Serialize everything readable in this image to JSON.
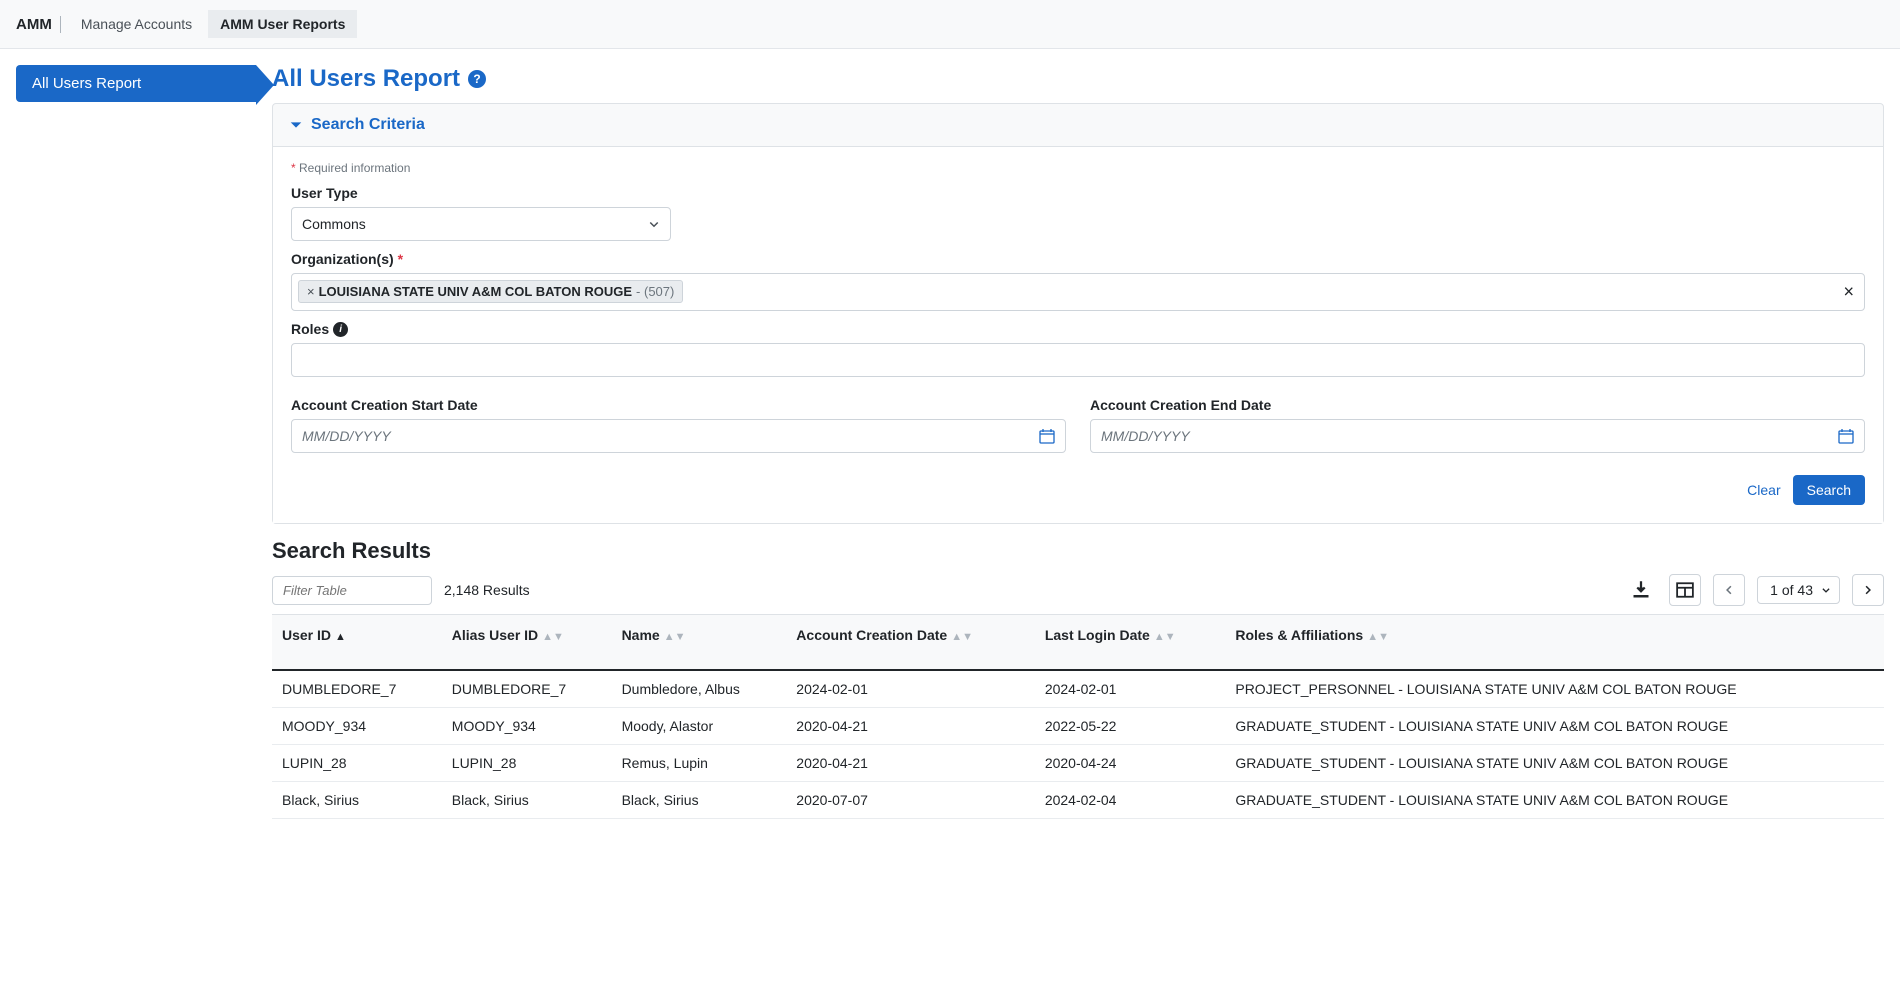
{
  "topnav": {
    "brand": "AMM",
    "items": [
      "Manage Accounts",
      "AMM User Reports"
    ],
    "active_index": 1
  },
  "sidebar": {
    "active_label": "All Users Report"
  },
  "page": {
    "title": "All Users Report"
  },
  "search_criteria": {
    "header": "Search Criteria",
    "required_note": "Required information",
    "user_type_label": "User Type",
    "user_type_value": "Commons",
    "org_label": "Organization(s)",
    "org_chip_name": "LOUISIANA STATE UNIV A&M COL BATON ROUGE",
    "org_chip_count": "- (507)",
    "roles_label": "Roles",
    "start_date_label": "Account Creation Start Date",
    "end_date_label": "Account Creation End Date",
    "date_placeholder": "MM/DD/YYYY",
    "clear_label": "Clear",
    "search_label": "Search"
  },
  "results": {
    "title": "Search Results",
    "filter_placeholder": "Filter Table",
    "count_text": "2,148 Results",
    "pager_text": "1 of 43",
    "columns": {
      "user_id": "User ID",
      "alias": "Alias User ID",
      "name": "Name",
      "created": "Account Creation Date",
      "last_login": "Last Login Date",
      "roles": "Roles & Affiliations"
    },
    "rows": [
      {
        "user_id": "DUMBLEDORE_7",
        "alias": "DUMBLEDORE_7",
        "name": "Dumbledore, Albus",
        "created": "2024-02-01",
        "last_login": "2024-02-01",
        "roles": "PROJECT_PERSONNEL - LOUISIANA STATE UNIV A&M COL BATON ROUGE"
      },
      {
        "user_id": "MOODY_934",
        "alias": "MOODY_934",
        "name": "Moody, Alastor",
        "created": "2020-04-21",
        "last_login": "2022-05-22",
        "roles": "GRADUATE_STUDENT - LOUISIANA STATE UNIV A&M COL BATON ROUGE"
      },
      {
        "user_id": "LUPIN_28",
        "alias": "LUPIN_28",
        "name": "Remus, Lupin",
        "created": "2020-04-21",
        "last_login": "2020-04-24",
        "roles": "GRADUATE_STUDENT - LOUISIANA STATE UNIV A&M COL BATON ROUGE"
      },
      {
        "user_id": "Black, Sirius",
        "alias": "Black, Sirius",
        "name": "Black, Sirius",
        "created": "2020-07-07",
        "last_login": "2024-02-04",
        "roles": "GRADUATE_STUDENT - LOUISIANA STATE UNIV A&M COL BATON ROUGE"
      }
    ]
  }
}
